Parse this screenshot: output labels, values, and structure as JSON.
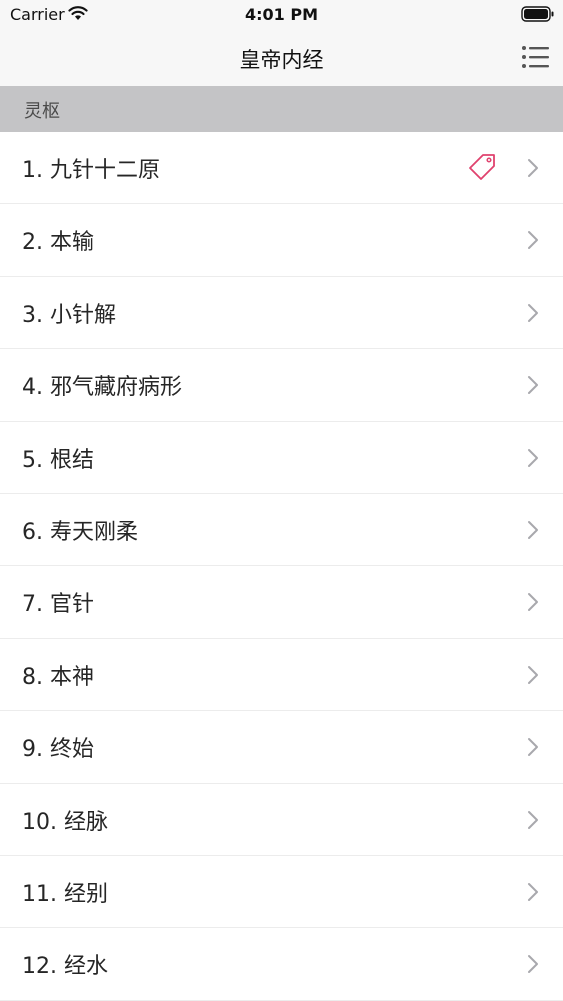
{
  "status_bar": {
    "carrier": "Carrier",
    "time": "4:01 PM",
    "wifi_icon": "wifi-icon",
    "battery_icon": "battery-icon"
  },
  "nav": {
    "title": "皇帝内经",
    "menu_icon": "list-menu-icon"
  },
  "section": {
    "title": "灵枢"
  },
  "colors": {
    "tag_accent": "#e0426e",
    "section_bg": "#c4c4c6",
    "chevron": "#a8a8ad"
  },
  "chapters": [
    {
      "label": "1. 九针十二原",
      "tagged": true
    },
    {
      "label": "2. 本输",
      "tagged": false
    },
    {
      "label": "3. 小针解",
      "tagged": false
    },
    {
      "label": "4. 邪气藏府病形",
      "tagged": false
    },
    {
      "label": "5. 根结",
      "tagged": false
    },
    {
      "label": "6. 寿天刚柔",
      "tagged": false
    },
    {
      "label": "7. 官针",
      "tagged": false
    },
    {
      "label": "8. 本神",
      "tagged": false
    },
    {
      "label": "9. 终始",
      "tagged": false
    },
    {
      "label": "10. 经脉",
      "tagged": false
    },
    {
      "label": "11. 经别",
      "tagged": false
    },
    {
      "label": "12. 经水",
      "tagged": false
    }
  ]
}
